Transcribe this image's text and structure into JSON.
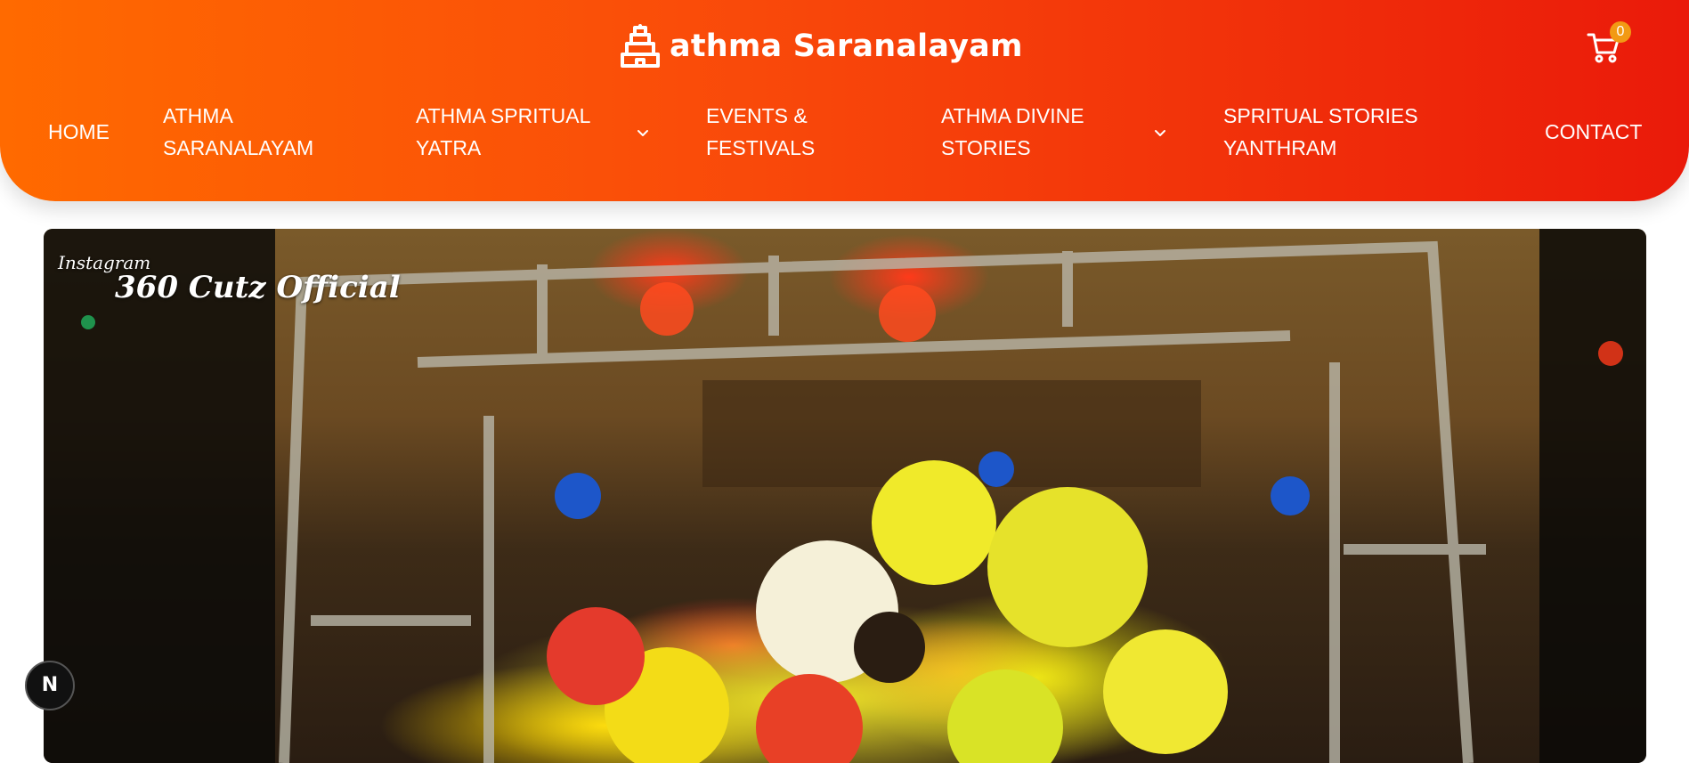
{
  "header": {
    "brand_name": "athma Saranalayam",
    "brand_icon": "temple-gopuram-icon",
    "cart_icon": "shopping-cart-icon",
    "cart_count": "0",
    "gradient_start": "#ff6a00",
    "gradient_end": "#ea1a0a"
  },
  "nav": {
    "home": "HOME",
    "athma_saranalayam": [
      "ATHMA",
      "SARANALAYAM"
    ],
    "athma_spritual_yatra": [
      "ATHMA SPRITUAL",
      "YATRA"
    ],
    "events_festivals": [
      "EVENTS &",
      "FESTIVALS"
    ],
    "athma_divine_stories": [
      "ATHMA DIVINE",
      "STORIES"
    ],
    "spritual_stories_yanthram": [
      "SPRITUAL STORIES",
      "YANTHRAM"
    ],
    "contact": "CONTACT"
  },
  "hero": {
    "watermark_top": "Instagram",
    "watermark_main": "360 Cutz Official"
  },
  "dev_badge": {
    "label": "N"
  }
}
